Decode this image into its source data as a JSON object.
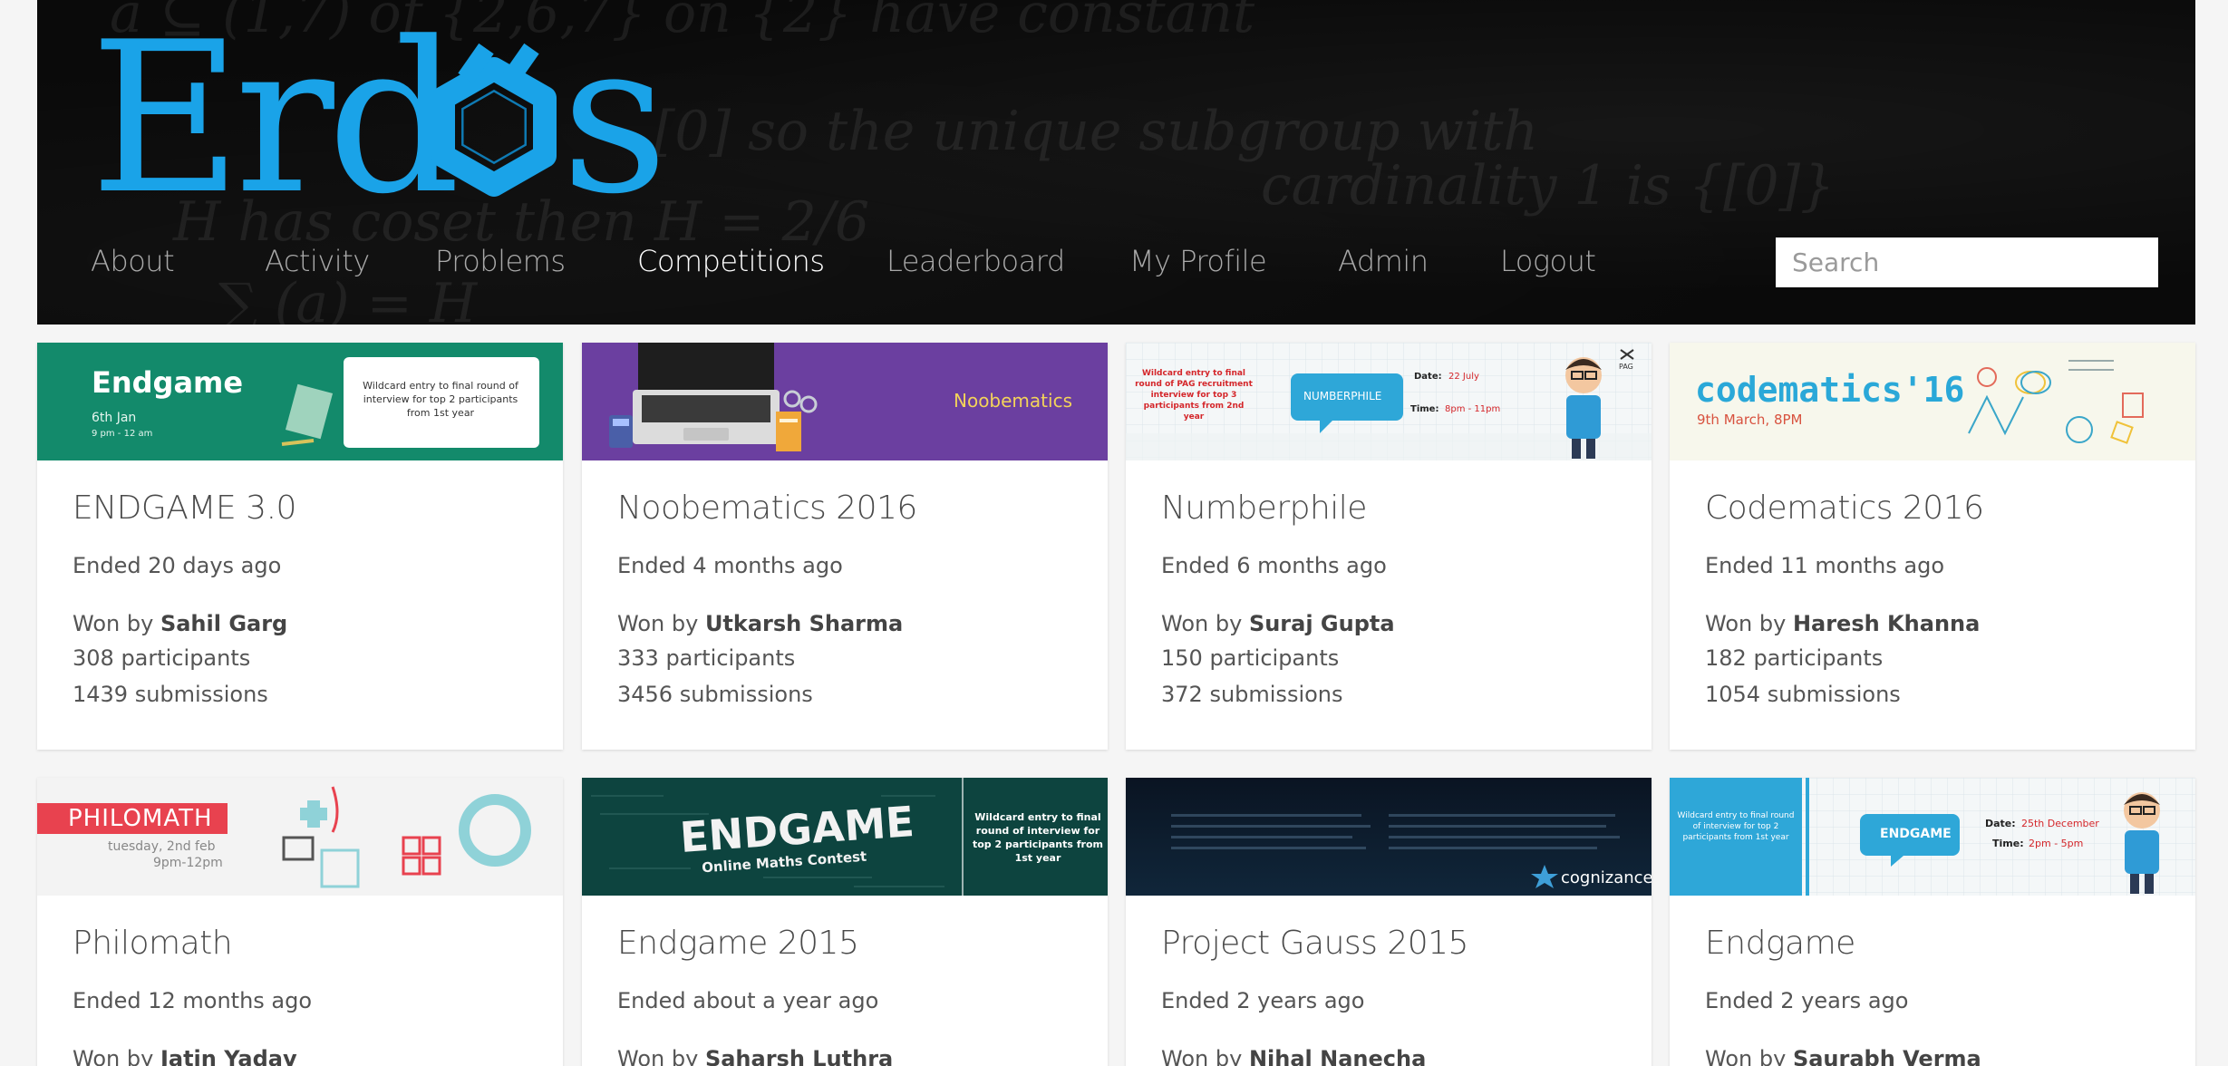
{
  "brand": {
    "logo_text": "Erdős",
    "accent_color": "#1aa3e8"
  },
  "nav": {
    "items": [
      {
        "label": "About",
        "active": false
      },
      {
        "label": "Activity",
        "active": false
      },
      {
        "label": "Problems",
        "active": false
      },
      {
        "label": "Competitions",
        "active": true
      },
      {
        "label": "Leaderboard",
        "active": false
      },
      {
        "label": "My Profile",
        "active": false
      },
      {
        "label": "Admin",
        "active": false
      },
      {
        "label": "Logout",
        "active": false
      }
    ]
  },
  "search": {
    "placeholder": "Search",
    "value": ""
  },
  "competitions": [
    {
      "title": "ENDGAME 3.0",
      "status": "Ended 20 days ago",
      "won_by_prefix": "Won by",
      "winner": "Sahil Garg",
      "participants": "308 participants",
      "submissions": "1439 submissions",
      "banner": {
        "heading": "Endgame",
        "date": "6th Jan",
        "time": "9 pm - 12 am",
        "note": "Wildcard entry to final round of interview for top 2 participants from 1st year",
        "bg": "#138a6b"
      }
    },
    {
      "title": "Noobematics 2016",
      "status": "Ended 4 months ago",
      "won_by_prefix": "Won by",
      "winner": "Utkarsh Sharma",
      "participants": "333 participants",
      "submissions": "3456 submissions",
      "banner": {
        "heading": "Noobematics",
        "bg": "#6b3fa0"
      }
    },
    {
      "title": "Numberphile",
      "status": "Ended 6 months ago",
      "won_by_prefix": "Won by",
      "winner": "Suraj Gupta",
      "participants": "150 participants",
      "submissions": "372 submissions",
      "banner": {
        "heading": "NUMBERPHILE",
        "note": "Wildcard entry to final round of PAG recruitment interview for top 3 participants from 2nd year",
        "date_label": "Date:",
        "date": "22 July",
        "time_label": "Time:",
        "time": "8pm - 11pm",
        "corner": "PAG",
        "bg": "#f4f7f8"
      }
    },
    {
      "title": "Codematics 2016",
      "status": "Ended 11 months ago",
      "won_by_prefix": "Won by",
      "winner": "Haresh Khanna",
      "participants": "182 participants",
      "submissions": "1054 submissions",
      "banner": {
        "heading": "codematics'16",
        "date": "9th March, 8PM",
        "bg": "#f7f7ec"
      }
    },
    {
      "title": "Philomath",
      "status": "Ended 12 months ago",
      "won_by_prefix": "Won by",
      "winner": "Jatin Yadav",
      "banner": {
        "heading": "PHILOMATH",
        "date": "tuesday, 2nd feb",
        "time": "9pm-12pm",
        "bg": "#f3f3f3"
      }
    },
    {
      "title": "Endgame 2015",
      "status": "Ended about a year ago",
      "won_by_prefix": "Won by",
      "winner": "Saharsh Luthra",
      "banner": {
        "heading": "ENDGAME",
        "sub": "Online Maths Contest",
        "note": "Wildcard entry to final round of interview for top 2 participants from 1st year",
        "bg": "#0f4a45"
      }
    },
    {
      "title": "Project Gauss 2015",
      "status": "Ended 2 years ago",
      "won_by_prefix": "Won by",
      "winner": "Nihal Nanecha",
      "banner": {
        "heading": "cognizance",
        "bg": "#0c1a2a"
      }
    },
    {
      "title": "Endgame",
      "status": "Ended 2 years ago",
      "won_by_prefix": "Won by",
      "winner": "Saurabh Verma",
      "banner": {
        "heading": "ENDGAME",
        "note": "Wildcard entry to final round of interview for top 2 participants from 1st year",
        "date_label": "Date:",
        "date": "25th December",
        "time_label": "Time:",
        "time": "2pm - 5pm",
        "bg": "#f4f7f8"
      }
    }
  ]
}
